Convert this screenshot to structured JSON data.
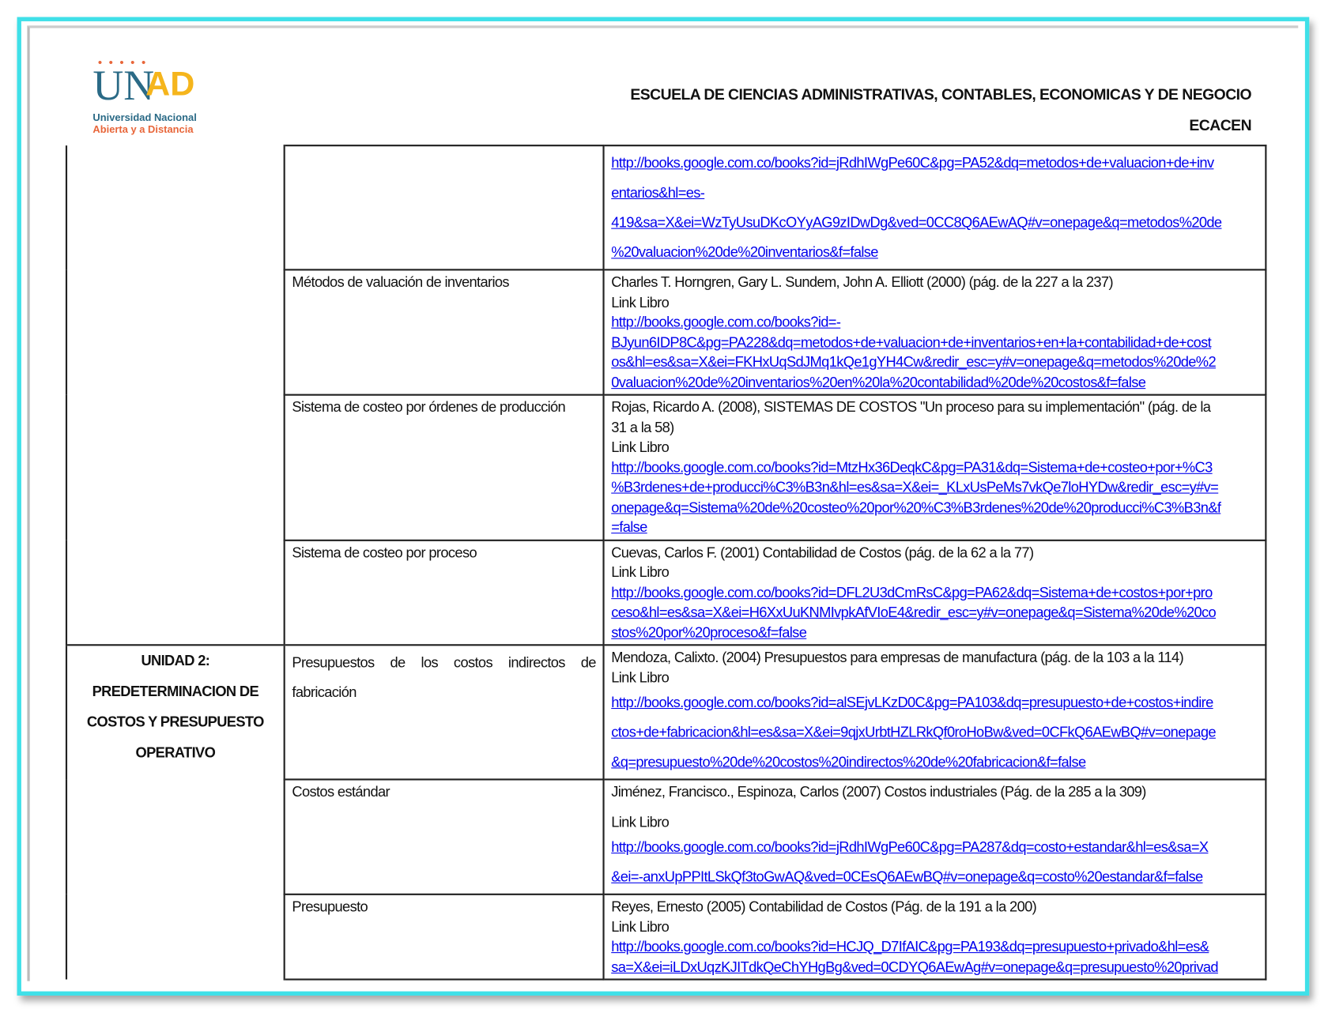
{
  "header": {
    "logo_text": "UNAD",
    "logo_line1": "Universidad Nacional",
    "logo_line2": "Abierta y a Distancia",
    "school": "ESCUELA DE CIENCIAS ADMINISTRATIVAS, CONTABLES, ECONOMICAS Y DE NEGOCIO",
    "acronym": "ECACEN"
  },
  "unit2": {
    "lines": [
      "UNIDAD 2:",
      "PREDETERMINACION DE",
      "COSTOS Y PRESUPUESTO",
      "OPERATIVO"
    ]
  },
  "rows": [
    {
      "topic": "",
      "ref": [],
      "link_label": "",
      "link": [
        "http://books.google.com.co/books?id=jRdhIWgPe60C&pg=PA52&dq=metodos+de+valuacion+de+inv",
        "entarios&hl=es-",
        "419&sa=X&ei=WzTyUsuDKcOYyAG9zIDwDg&ved=0CC8Q6AEwAQ#v=onepage&q=metodos%20de",
        "%20valuacion%20de%20inventarios&f=false"
      ]
    },
    {
      "topic": "Métodos de valuación de inventarios",
      "ref": [
        "Charles T. Horngren, Gary L. Sundem, John A. Elliott  (2000) (pág. de la 227 a la 237)"
      ],
      "link_label": "Link Libro",
      "link": [
        "http://books.google.com.co/books?id=-",
        "BJyun6IDP8C&pg=PA228&dq=metodos+de+valuacion+de+inventarios+en+la+contabilidad+de+cost",
        "os&hl=es&sa=X&ei=FKHxUqSdJMq1kQe1gYH4Cw&redir_esc=y#v=onepage&q=metodos%20de%2",
        "0valuacion%20de%20inventarios%20en%20la%20contabilidad%20de%20costos&f=false"
      ]
    },
    {
      "topic": "Sistema de costeo por órdenes de producción",
      "ref": [
        "Rojas, Ricardo A. (2008), SISTEMAS DE COSTOS \"Un proceso para su implementación\" (pág. de la",
        "31 a la 58)"
      ],
      "link_label": "Link Libro",
      "link": [
        "http://books.google.com.co/books?id=MtzHx36DeqkC&pg=PA31&dq=Sistema+de+costeo+por+%C3",
        "%B3rdenes+de+producci%C3%B3n&hl=es&sa=X&ei=_KLxUsPeMs7vkQe7loHYDw&redir_esc=y#v=",
        "onepage&q=Sistema%20de%20costeo%20por%20%C3%B3rdenes%20de%20producci%C3%B3n&f",
        "=false"
      ]
    },
    {
      "topic": "Sistema de costeo por proceso",
      "ref": [
        "Cuevas, Carlos F. (2001) Contabilidad de Costos (pág. de la 62 a la 77)"
      ],
      "link_label": "Link Libro",
      "link": [
        "http://books.google.com.co/books?id=DFL2U3dCmRsC&pg=PA62&dq=Sistema+de+costos+por+pro",
        "ceso&hl=es&sa=X&ei=H6XxUuKNMIvpkAfVIoE4&redir_esc=y#v=onepage&q=Sistema%20de%20co",
        "stos%20por%20proceso&f=false"
      ]
    },
    {
      "topic": "Presupuestos de los costos indirectos de fabricación",
      "ref": [
        "Mendoza, Calixto. (2004) Presupuestos para empresas de manufactura (pág. de la 103 a la 114)"
      ],
      "link_label": "Link Libro",
      "link": [
        "http://books.google.com.co/books?id=alSEjvLKzD0C&pg=PA103&dq=presupuesto+de+costos+indire",
        "ctos+de+fabricacion&hl=es&sa=X&ei=9qjxUrbtHZLRkQf0roHoBw&ved=0CFkQ6AEwBQ#v=onepage",
        "&q=presupuesto%20de%20costos%20indirectos%20de%20fabricacion&f=false"
      ]
    },
    {
      "topic": "Costos estándar",
      "ref": [
        "Jiménez, Francisco., Espinoza, Carlos (2007) Costos industriales (Pág. de la 285 a la 309)"
      ],
      "link_label": "Link Libro",
      "link": [
        "http://books.google.com.co/books?id=jRdhIWgPe60C&pg=PA287&dq=costo+estandar&hl=es&sa=X",
        "&ei=-anxUpPPItLSkQf3toGwAQ&ved=0CEsQ6AEwBQ#v=onepage&q=costo%20estandar&f=false"
      ]
    },
    {
      "topic": "Presupuesto",
      "ref": [
        "Reyes, Ernesto (2005) Contabilidad de Costos (Pág. de la 191 a la 200)"
      ],
      "link_label": "Link Libro",
      "link": [
        "http://books.google.com.co/books?id=HCJQ_D7IfAIC&pg=PA193&dq=presupuesto+privado&hl=es&",
        "sa=X&ei=iLDxUqzKJITdkQeChYHgBg&ved=0CDYQ6AEwAg#v=onepage&q=presupuesto%20privad"
      ]
    }
  ]
}
